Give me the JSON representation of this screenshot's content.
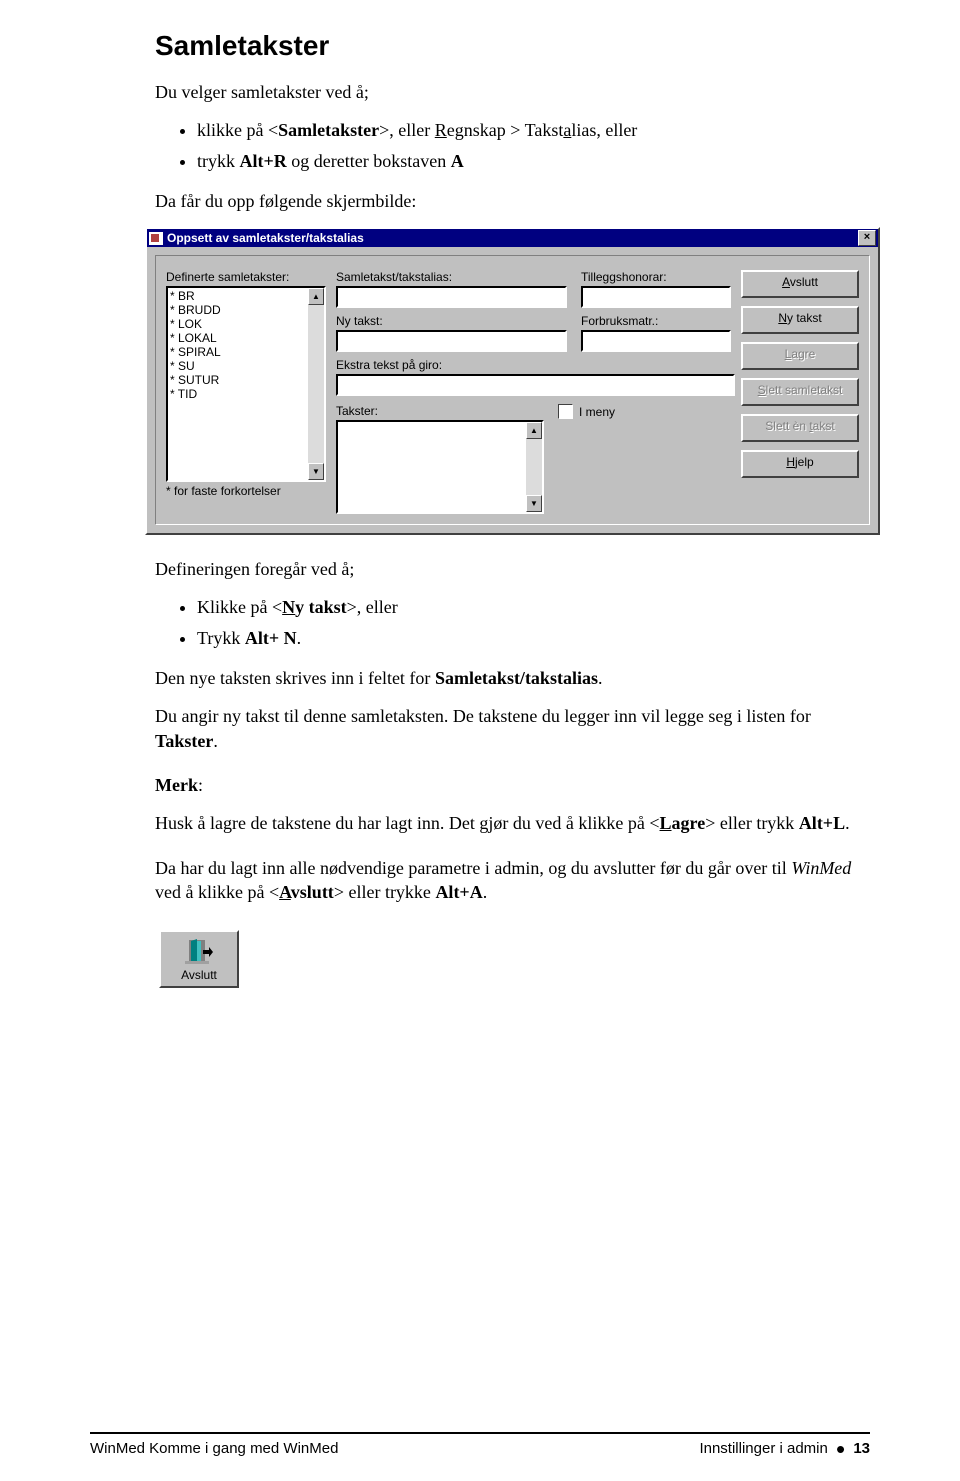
{
  "heading": "Samletakster",
  "intro": "Du velger samletakster ved å;",
  "bullets1": {
    "b1_pre": "klikke på <",
    "b1_bold": "Samletakster",
    "b1_mid": ">, eller ",
    "b1_u": "R",
    "b1_rest1": "egnskap > Takst",
    "b1_u2": "a",
    "b1_rest2": "lias, eller",
    "b2_pre": "trykk ",
    "b2_bold": "Alt+R",
    "b2_mid": " og deretter bokstaven ",
    "b2_bold2": "A"
  },
  "after1": "Da får du opp følgende skjermbilde:",
  "dialog": {
    "title": "Oppsett av samletakster/takstalias",
    "definerte_label": "Definerte samletakster:",
    "items": [
      "* BR",
      "* BRUDD",
      "* LOK",
      "* LOKAL",
      "* SPIRAL",
      "* SU",
      "* SUTUR",
      "* TID"
    ],
    "note": "* for faste forkortelser",
    "samletakst_label": "Samletakst/takstalias:",
    "tillegg_label": "Tilleggshonorar:",
    "nytakst_label": "Ny takst:",
    "forbruk_label": "Forbruksmatr.:",
    "ekstra_label": "Ekstra tekst på giro:",
    "takster_label": "Takster:",
    "imeny_label": "I meny",
    "buttons": {
      "avslutt": "Avslutt",
      "nytakst": "Ny takst",
      "lagre": "Lagre",
      "slett_samletakst": "Slett samletakst",
      "slett_en_takst": "Slett èn takst",
      "hjelp": "Hjelp"
    }
  },
  "defn_pre": "Defineringen foregår ved å;",
  "bullets2": {
    "b1_pre": "Klikke på <",
    "b1_u": "N",
    "b1_bold": "y takst",
    "b1_post": ">, eller",
    "b2_pre": "Trykk ",
    "b2_bold": "Alt+ N",
    "b2_post": "."
  },
  "p3_a": "Den nye taksten skrives inn i feltet for ",
  "p3_bold": "Samletakst/takstalias",
  "p3_b": ".",
  "p4_a": "Du angir ny takst til denne samletaksten. De takstene du legger inn vil legge seg i listen for ",
  "p4_bold": "Takster",
  "p4_b": ".",
  "merk_label": "Merk",
  "p5_a": "Husk å lagre de takstene du har lagt inn. Det gjør du ved å klikke på <",
  "p5_u": "L",
  "p5_bold": "agre",
  "p5_b": "> eller trykk ",
  "p5_bold2": "Alt+L",
  "p5_c": ".",
  "p6_a": "Da har du lagt inn alle nødvendige parametre i admin, og du avslutter før du går over til ",
  "p6_i": "WinMed",
  "p6_b": " ved å klikke på <",
  "p6_u": "A",
  "p6_bold": "vslutt",
  "p6_c": "> eller trykke ",
  "p6_bold2": "Alt+A",
  "p6_d": ".",
  "avslutt_btn_label": "Avslutt",
  "footer_left": "WinMed  Komme i gang med WinMed",
  "footer_right": "Innstillinger i admin",
  "footer_page": "13"
}
